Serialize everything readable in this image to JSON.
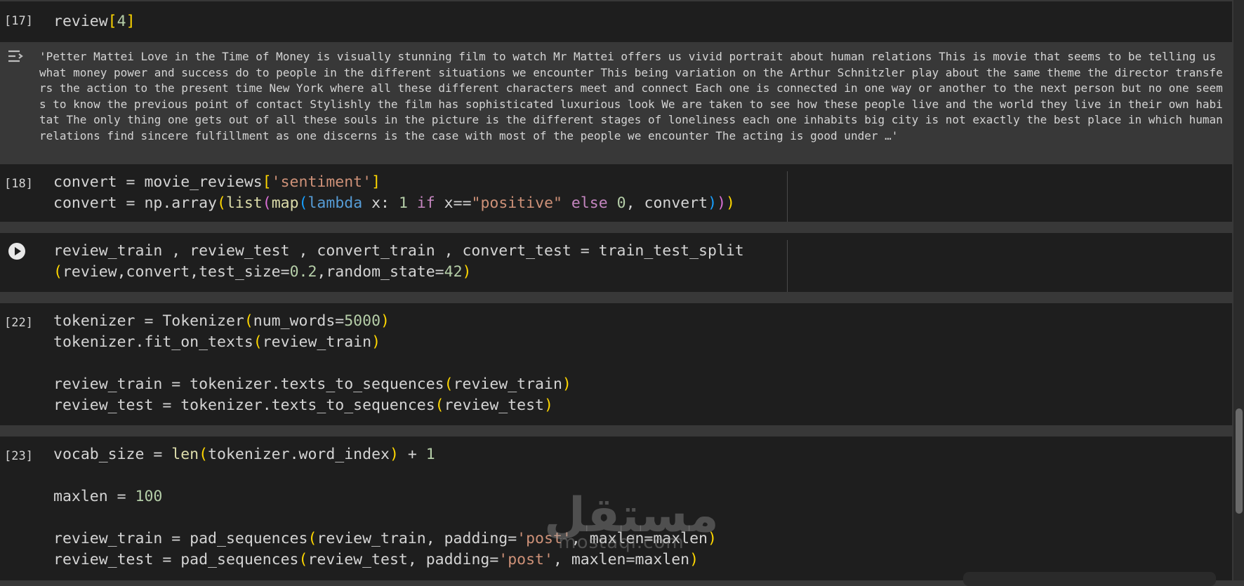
{
  "cells": [
    {
      "exec_count": "[17]",
      "code_lines": [
        [
          {
            "t": "review",
            "c": "t-var"
          },
          {
            "t": "[",
            "c": "b1"
          },
          {
            "t": "4",
            "c": "t-num"
          },
          {
            "t": "]",
            "c": "b1"
          }
        ]
      ],
      "output": {
        "icon": "output-collapse-icon",
        "text": "'Petter Mattei Love in the Time of Money is visually stunning film to watch Mr Mattei offers us vivid portrait about human relations This is movie that seems to be telling us what money power and success do to people in the different situations we encounter This being variation on the Arthur Schnitzler play about the same theme the director transfers the action to the present time New York where all these different characters meet and connect Each one is connected in one way or another to the next person but no one seems to know the previous point of contact Stylishly the film has sophisticated luxurious look We are taken to see how these people live and the world they live in their own habitat The only thing one gets out of all these souls in the picture is the different stages of loneliness each one inhabits big city is not exactly the best place in which human relations find sincere fulfillment as one discerns is the case with most of the people we encounter The acting is good under …'"
      }
    },
    {
      "exec_count": "[18]",
      "code_lines": [
        [
          {
            "t": "convert = movie_reviews",
            "c": "t-var"
          },
          {
            "t": "[",
            "c": "b1"
          },
          {
            "t": "'sentiment'",
            "c": "t-str"
          },
          {
            "t": "]",
            "c": "b1"
          }
        ],
        [
          {
            "t": "convert = np.array",
            "c": "t-var"
          },
          {
            "t": "(",
            "c": "b1"
          },
          {
            "t": "list",
            "c": "t-fn"
          },
          {
            "t": "(",
            "c": "b2"
          },
          {
            "t": "map",
            "c": "t-fn"
          },
          {
            "t": "(",
            "c": "b3"
          },
          {
            "t": "lambda",
            "c": "t-lam"
          },
          {
            "t": " x: ",
            "c": "t-var"
          },
          {
            "t": "1",
            "c": "t-num"
          },
          {
            "t": " ",
            "c": "t-var"
          },
          {
            "t": "if",
            "c": "t-kw"
          },
          {
            "t": " x==",
            "c": "t-var"
          },
          {
            "t": "\"positive\"",
            "c": "t-str"
          },
          {
            "t": " ",
            "c": "t-var"
          },
          {
            "t": "else",
            "c": "t-kw"
          },
          {
            "t": " ",
            "c": "t-var"
          },
          {
            "t": "0",
            "c": "t-num"
          },
          {
            "t": ", convert",
            "c": "t-var"
          },
          {
            "t": ")",
            "c": "b3"
          },
          {
            "t": ")",
            "c": "b2"
          },
          {
            "t": ")",
            "c": "b1"
          }
        ]
      ]
    },
    {
      "exec_count": "",
      "run_button": "run-cell-icon",
      "code_lines": [
        [
          {
            "t": "review_train , review_test , convert_train , convert_test = train_test_split",
            "c": "t-var"
          }
        ],
        [
          {
            "t": "(",
            "c": "b1"
          },
          {
            "t": "review,convert,test_size=",
            "c": "t-var"
          },
          {
            "t": "0.2",
            "c": "t-num"
          },
          {
            "t": ",random_state=",
            "c": "t-var"
          },
          {
            "t": "42",
            "c": "t-num"
          },
          {
            "t": ")",
            "c": "b1"
          }
        ]
      ]
    },
    {
      "exec_count": "[22]",
      "code_lines": [
        [
          {
            "t": "tokenizer = Tokenizer",
            "c": "t-var"
          },
          {
            "t": "(",
            "c": "b1"
          },
          {
            "t": "num_words=",
            "c": "t-var"
          },
          {
            "t": "5000",
            "c": "t-num"
          },
          {
            "t": ")",
            "c": "b1"
          }
        ],
        [
          {
            "t": "tokenizer.fit_on_texts",
            "c": "t-var"
          },
          {
            "t": "(",
            "c": "b1"
          },
          {
            "t": "review_train",
            "c": "t-var"
          },
          {
            "t": ")",
            "c": "b1"
          }
        ],
        [],
        [
          {
            "t": "review_train = tokenizer.texts_to_sequences",
            "c": "t-var"
          },
          {
            "t": "(",
            "c": "b1"
          },
          {
            "t": "review_train",
            "c": "t-var"
          },
          {
            "t": ")",
            "c": "b1"
          }
        ],
        [
          {
            "t": "review_test = tokenizer.texts_to_sequences",
            "c": "t-var"
          },
          {
            "t": "(",
            "c": "b1"
          },
          {
            "t": "review_test",
            "c": "t-var"
          },
          {
            "t": ")",
            "c": "b1"
          }
        ]
      ]
    },
    {
      "exec_count": "[23]",
      "code_lines": [
        [
          {
            "t": "vocab_size = ",
            "c": "t-var"
          },
          {
            "t": "len",
            "c": "t-fn"
          },
          {
            "t": "(",
            "c": "b1"
          },
          {
            "t": "tokenizer.word_index",
            "c": "t-var"
          },
          {
            "t": ")",
            "c": "b1"
          },
          {
            "t": " + ",
            "c": "t-var"
          },
          {
            "t": "1",
            "c": "t-num"
          }
        ],
        [],
        [
          {
            "t": "maxlen = ",
            "c": "t-var"
          },
          {
            "t": "100",
            "c": "t-num"
          }
        ],
        [],
        [
          {
            "t": "review_train = pad_sequences",
            "c": "t-var"
          },
          {
            "t": "(",
            "c": "b1"
          },
          {
            "t": "review_train, padding=",
            "c": "t-var"
          },
          {
            "t": "'post'",
            "c": "t-str"
          },
          {
            "t": ", maxlen=maxlen",
            "c": "t-var"
          },
          {
            "t": ")",
            "c": "b1"
          }
        ],
        [
          {
            "t": "review_test = pad_sequences",
            "c": "t-var"
          },
          {
            "t": "(",
            "c": "b1"
          },
          {
            "t": "review_test, padding=",
            "c": "t-var"
          },
          {
            "t": "'post'",
            "c": "t-str"
          },
          {
            "t": ", maxlen=maxlen",
            "c": "t-var"
          },
          {
            "t": ")",
            "c": "b1"
          }
        ]
      ]
    }
  ],
  "watermark": {
    "arabic": "مستقل",
    "latin": "mostaql.com"
  }
}
